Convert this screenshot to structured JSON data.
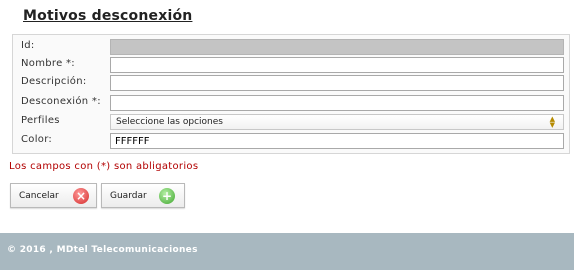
{
  "page": {
    "title": "Motivos desconexión"
  },
  "form": {
    "id": {
      "label": "Id:",
      "value": ""
    },
    "nombre": {
      "label": "Nombre *:",
      "value": ""
    },
    "descripcion": {
      "label": "Descripción:",
      "value": ""
    },
    "desconexion": {
      "label": "Desconexión *:",
      "value": ""
    },
    "perfiles": {
      "label": "Perfiles",
      "selected": "Seleccione las opciones"
    },
    "color": {
      "label": "Color:",
      "value": "FFFFFF"
    }
  },
  "note": "Los campos con (*) son abligatorios",
  "buttons": {
    "cancel": "Cancelar",
    "save": "Guardar"
  },
  "footer": {
    "text": "© 2016 , MDtel Telecomunicaciones"
  },
  "colors": {
    "note": "#b20000",
    "footer_bg": "#a8b8c0"
  }
}
